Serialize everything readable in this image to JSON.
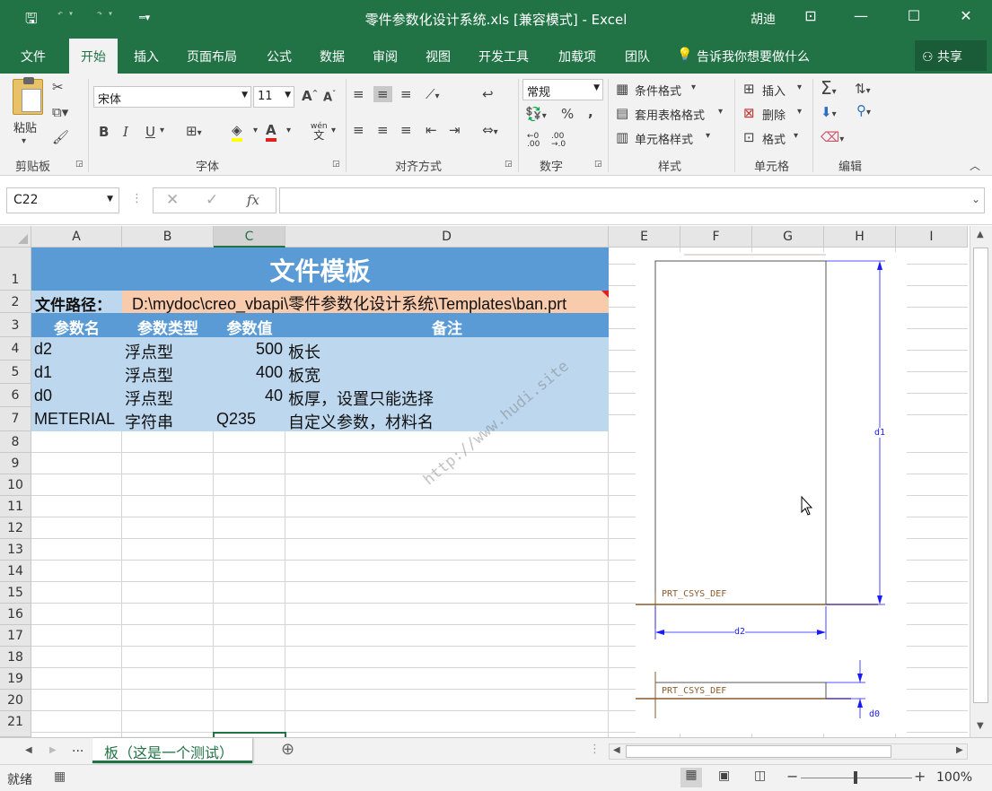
{
  "titlebar": {
    "title": "零件参数化设计系统.xls [兼容模式] - Excel",
    "user": "胡迪",
    "save_icon": "save-icon",
    "undo_icon": "undo-icon",
    "redo_icon": "redo-icon"
  },
  "tabs": [
    "文件",
    "开始",
    "插入",
    "页面布局",
    "公式",
    "数据",
    "审阅",
    "视图",
    "开发工具",
    "加载项",
    "团队"
  ],
  "active_tab": "开始",
  "tell_me": "告诉我你想要做什么",
  "share": "共享",
  "ribbon": {
    "clipboard": {
      "paste": "粘贴",
      "group": "剪贴板"
    },
    "font": {
      "name": "宋体",
      "size": "11",
      "bold": "B",
      "italic": "I",
      "underline": "U",
      "group": "字体",
      "wen": "wén",
      "wen2": "文"
    },
    "alignment": {
      "group": "对齐方式"
    },
    "number": {
      "format": "常规",
      "group": "数字",
      "percent": "%",
      "comma": ","
    },
    "styles": {
      "conditional": "条件格式",
      "table": "套用表格格式",
      "cell": "单元格样式",
      "group": "样式"
    },
    "cells": {
      "insert": "插入",
      "delete": "删除",
      "format": "格式",
      "group": "单元格"
    },
    "editing": {
      "group": "编辑"
    }
  },
  "formula_bar": {
    "name_box": "C22",
    "fx": "fx",
    "value": ""
  },
  "columns": [
    "A",
    "B",
    "C",
    "D",
    "E",
    "F",
    "G",
    "H",
    "I"
  ],
  "rows": [
    "1",
    "2",
    "3",
    "4",
    "5",
    "6",
    "7",
    "8",
    "9",
    "10",
    "11",
    "12",
    "13",
    "14",
    "15",
    "16",
    "17",
    "18",
    "19",
    "20",
    "21"
  ],
  "sheet": {
    "title": "文件模板",
    "path_label": "文件路径：",
    "path_value": "D:\\mydoc\\creo_vbapi\\零件参数化设计系统\\Templates\\ban.prt",
    "headers": [
      "参数名",
      "参数类型",
      "参数值",
      "备注"
    ],
    "data_rows": [
      [
        "d2",
        "浮点型",
        "500",
        "板长"
      ],
      [
        "d1",
        "浮点型",
        "400",
        "板宽"
      ],
      [
        "d0",
        "浮点型",
        "40",
        "板厚，设置只能选择"
      ],
      [
        "METERIAL",
        "字符串",
        "Q235",
        "自定义参数，材料名"
      ]
    ]
  },
  "watermark": "http://www.hudi.site",
  "drawing": {
    "csys1": "PRT_CSYS_DEF",
    "csys2": "PRT_CSYS_DEF",
    "dim_d1": "d1",
    "dim_d2": "d2",
    "dim_d0": "d0"
  },
  "sheet_tab": "板（这是一个测试）",
  "status": {
    "ready": "就绪",
    "zoom": "100%"
  }
}
